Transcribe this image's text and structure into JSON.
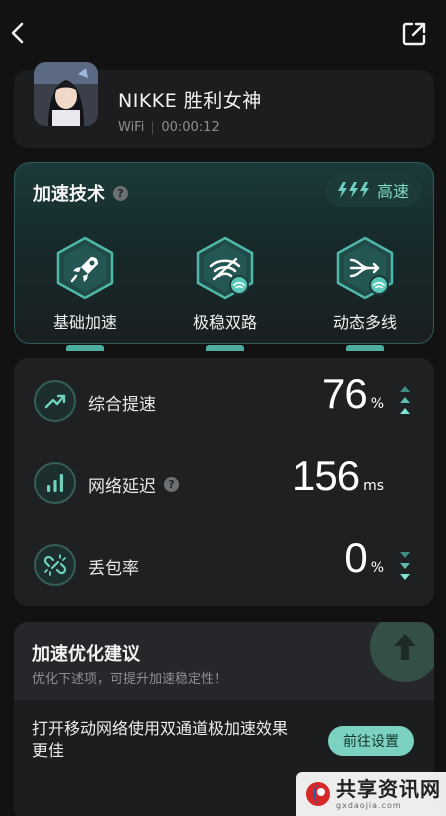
{
  "header": {
    "back_icon": "chevron-left-icon",
    "share_icon": "share-external-icon"
  },
  "game": {
    "title": "NIKKE 胜利女神",
    "network": "WiFi",
    "elapsed": "00:00:12"
  },
  "tech": {
    "title": "加速技术",
    "help_icon": "?",
    "speed_mode": "高速",
    "items": [
      {
        "label": "基础加速",
        "icon": "rocket-icon"
      },
      {
        "label": "极稳双路",
        "icon": "wifi-dual-icon"
      },
      {
        "label": "动态多线",
        "icon": "multiline-icon"
      }
    ],
    "accent": "#58c9b9"
  },
  "stats": [
    {
      "label": "综合提速",
      "value": "76",
      "unit": "%",
      "icon": "trend-up-icon",
      "arrows": "up"
    },
    {
      "label": "网络延迟",
      "value": "156",
      "unit": "ms",
      "icon": "signal-bars-icon",
      "arrows": "none",
      "help": true
    },
    {
      "label": "丢包率",
      "value": "0",
      "unit": "%",
      "icon": "broken-link-icon",
      "arrows": "down"
    }
  ],
  "suggest": {
    "title": "加速优化建议",
    "subtitle": "优化下述项，可提升加速稳定性！",
    "tip": "打开移动网络使用双通道极加速效果更佳",
    "button": "前往设置"
  },
  "watermark": {
    "main": "共享资讯网",
    "sub": "gxdaojia.com"
  }
}
